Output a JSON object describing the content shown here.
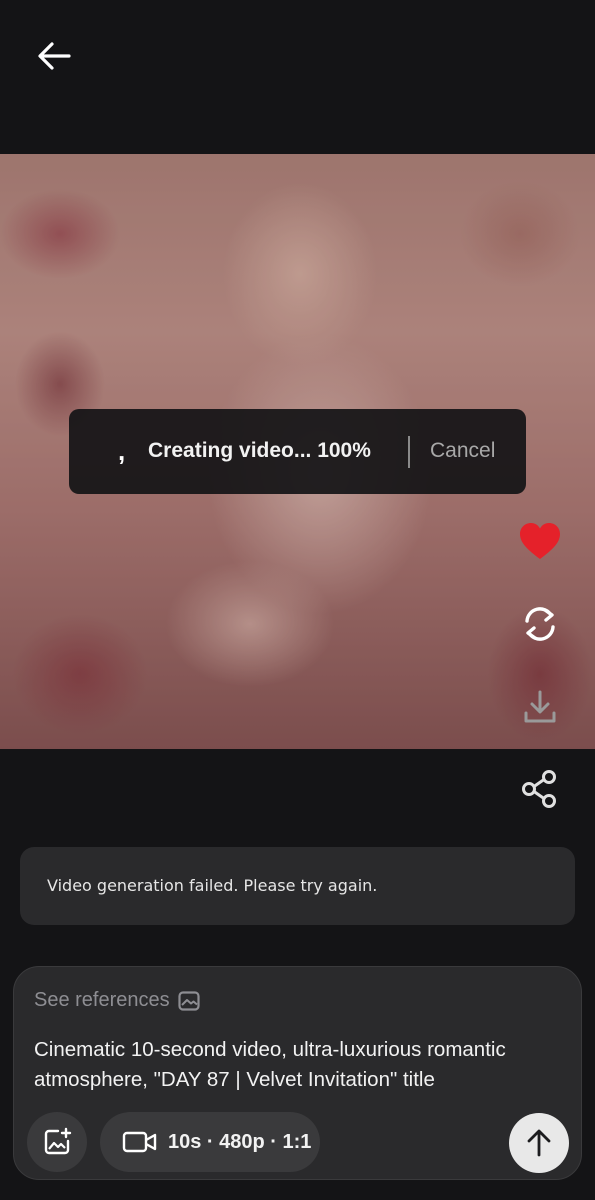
{
  "header": {
    "back_icon": "arrow-left-icon"
  },
  "media": {
    "description_hidden": true
  },
  "toast": {
    "spinner_glyph": ",",
    "status_text": "Creating video... 100%",
    "cancel_label": "Cancel"
  },
  "side_actions": {
    "like_icon": "heart-icon",
    "regenerate_icon": "refresh-icon",
    "download_icon": "download-icon",
    "share_icon": "share-icon",
    "like_color": "#e5212a"
  },
  "error": {
    "message": "Video generation failed. Please try again."
  },
  "composer": {
    "see_references_label": "See references",
    "prompt": "Cinematic 10-second video, ultra-luxurious romantic atmosphere, \"DAY 87 | Velvet Invitation\" title",
    "settings_label": "10s · 480p · 1:1",
    "add_image_icon": "add-image-icon",
    "video_icon": "video-camera-icon",
    "send_icon": "arrow-up-icon"
  }
}
